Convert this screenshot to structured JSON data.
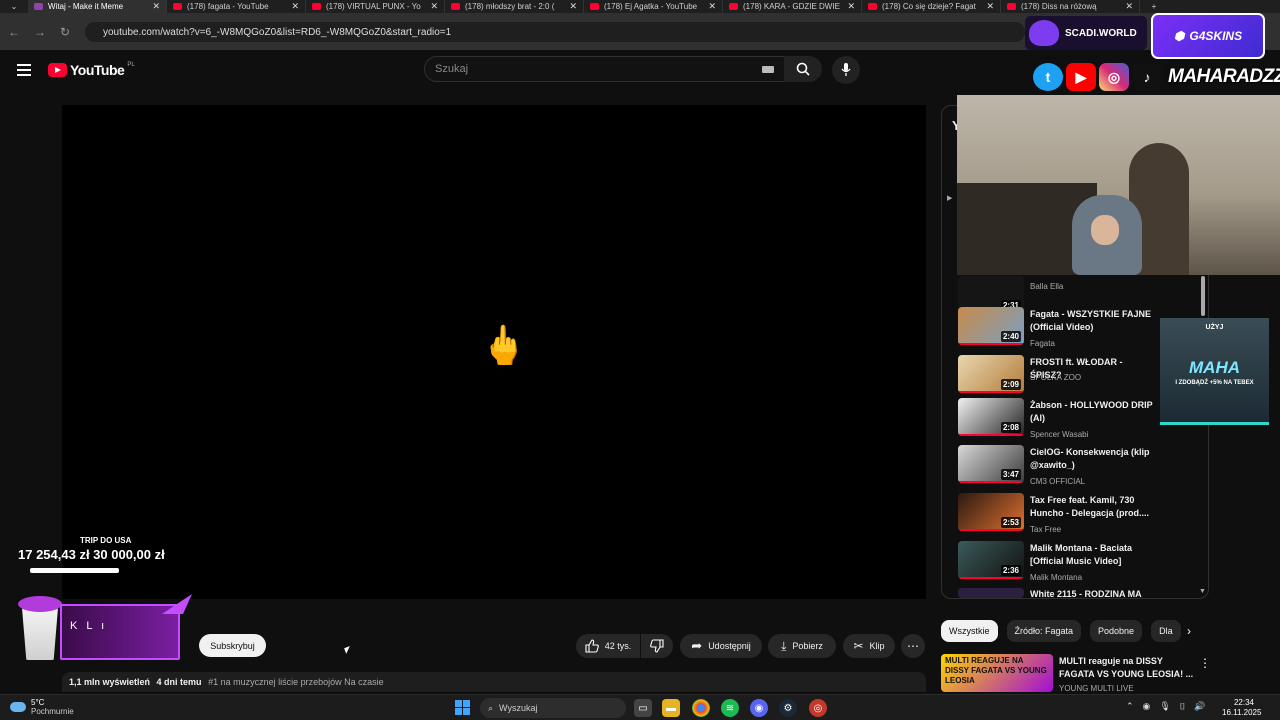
{
  "browser": {
    "tabs": [
      {
        "label": "Witaj - Make it Meme",
        "icon": "meme-favicon"
      },
      {
        "label": "(178) fagata - YouTube",
        "icon": "youtube-favicon"
      },
      {
        "label": "(178) VIRTUAL PUNX - Yo",
        "icon": "youtube-favicon"
      },
      {
        "label": "(178) młodszy brat - 2:0 (",
        "icon": "youtube-favicon"
      },
      {
        "label": "(178) Ej Agatka - YouTube",
        "icon": "youtube-favicon"
      },
      {
        "label": "(178) KARA - GDZIE DWIE",
        "icon": "youtube-favicon"
      },
      {
        "label": "(178) Co się dzieje? Fagat",
        "icon": "youtube-favicon"
      },
      {
        "label": "(178) Diss na różową",
        "icon": "youtube-favicon"
      }
    ],
    "new_tab": "+",
    "url": "youtube.com/watch?v=6_-W8MQGoZ0&list=RD6_-W8MQGoZ0&start_radio=1"
  },
  "youtube": {
    "logo_text": "YouTube",
    "country_code": "PL",
    "search_placeholder": "Szukaj"
  },
  "overlay": {
    "scadi": "SCADI.WORLD",
    "g4skins": "G4SKINS",
    "handle": "MAHARADZZA",
    "donation_label": "TRIP DO USA",
    "donation_amounts": "17 254,43 zł  30 000,00 zł",
    "donation_progress": 0.575,
    "kl_text": "K L ı",
    "promo_top": "UŻYJ",
    "promo_code": "MAHA",
    "promo_sub": "I ZDOBĄDŹ +5% NA TEBEX"
  },
  "player": {
    "emoji": "🖕"
  },
  "actions": {
    "subscribe": "Subskrybuj",
    "likes": "42 tys.",
    "share": "Udostępnij",
    "download": "Pobierz",
    "clip": "Klip",
    "more": "⋯"
  },
  "description": {
    "views": "1,1 mln wyświetleń",
    "age": "4 dni temu",
    "tags": "#1 na muzycznej liście przebojów Na czasie"
  },
  "playlist": {
    "header": "Y",
    "items": [
      {
        "title": "",
        "channel": "Balla Ella",
        "duration": "2:31",
        "progress": 1
      },
      {
        "title": "Fagata - WSZYSTKIE FAJNE (Official Video)",
        "channel": "Fagata",
        "duration": "2:40",
        "progress": 1
      },
      {
        "title": "FROSTI ft. WŁODAR - ŚPISZ?",
        "channel": "SPÓŁKA ZOO",
        "duration": "2:09",
        "progress": 1
      },
      {
        "title": "Żabson - HOLLYWOOD DRIP (AI)",
        "channel": "Spencer Wasabi",
        "duration": "2:08",
        "progress": 1
      },
      {
        "title": "CielOG- Konsekwencja (klip @xawito_)",
        "channel": "CM3 OFFICIAL",
        "duration": "3:47",
        "progress": 1
      },
      {
        "title": "Tax Free feat. Kamil, 730 Huncho - Delegacja (prod....",
        "channel": "Tax Free",
        "duration": "2:53",
        "progress": 1
      },
      {
        "title": "Malik Montana - Baciata [Official Music Video]",
        "channel": "Malik Montana",
        "duration": "2:36",
        "progress": 1
      },
      {
        "title": "White 2115 - RODZINA MA",
        "channel": "",
        "duration": "",
        "progress": 1
      }
    ]
  },
  "chips": [
    "Wszystkie",
    "Źródło: Fagata",
    "Podobne",
    "Dla"
  ],
  "recommendation": {
    "thumb_text": "MULTI REAGUJE NA DISSY FAGATA VS YOUNG LEOSIA",
    "title": "MULTI reaguje na DISSY FAGATA VS YOUNG LEOSIA! ...",
    "channel": "YOUNG MULTI LIVE"
  },
  "taskbar": {
    "temp": "5°C",
    "weather": "Pochmurnie",
    "search": "Wyszukaj",
    "time": "22:34",
    "date": "16.11.2025"
  }
}
